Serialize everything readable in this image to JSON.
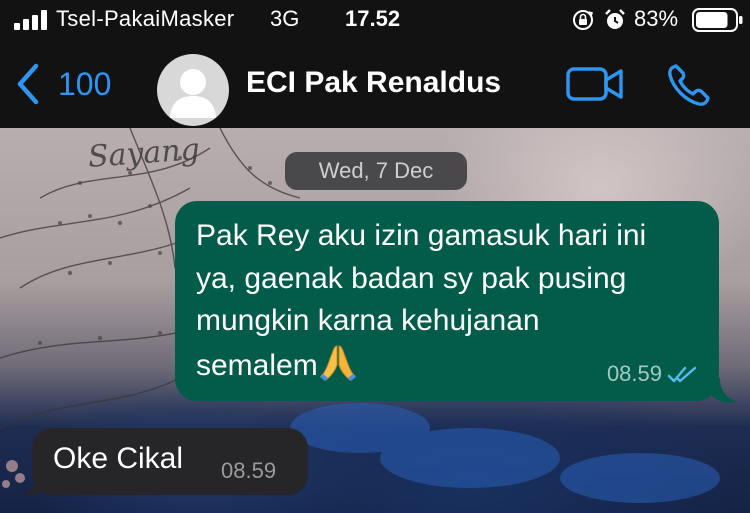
{
  "status_bar": {
    "carrier": "Tsel-PakaiMasker",
    "network": "3G",
    "time": "17.52",
    "battery_percent": "83%",
    "battery_level": 0.83
  },
  "header": {
    "back_count": "100",
    "contact_name": "ECI Pak Renaldus",
    "accent_color": "#2e95f0"
  },
  "chat": {
    "date_label": "Wed, 7 Dec",
    "wallpaper_text": "Sayang",
    "messages": [
      {
        "direction": "outgoing",
        "text": "Pak Rey aku izin gamasuk hari ini\nya, gaenak badan sy pak pusing\nmungkin karna kehujanan\nsemalem",
        "emoji": "folded-hands",
        "time": "08.59",
        "status": "read",
        "bubble_color": "#035c4a"
      },
      {
        "direction": "incoming",
        "text": "Oke Cikal",
        "time": "08.59",
        "bubble_color": "#262628"
      }
    ]
  }
}
